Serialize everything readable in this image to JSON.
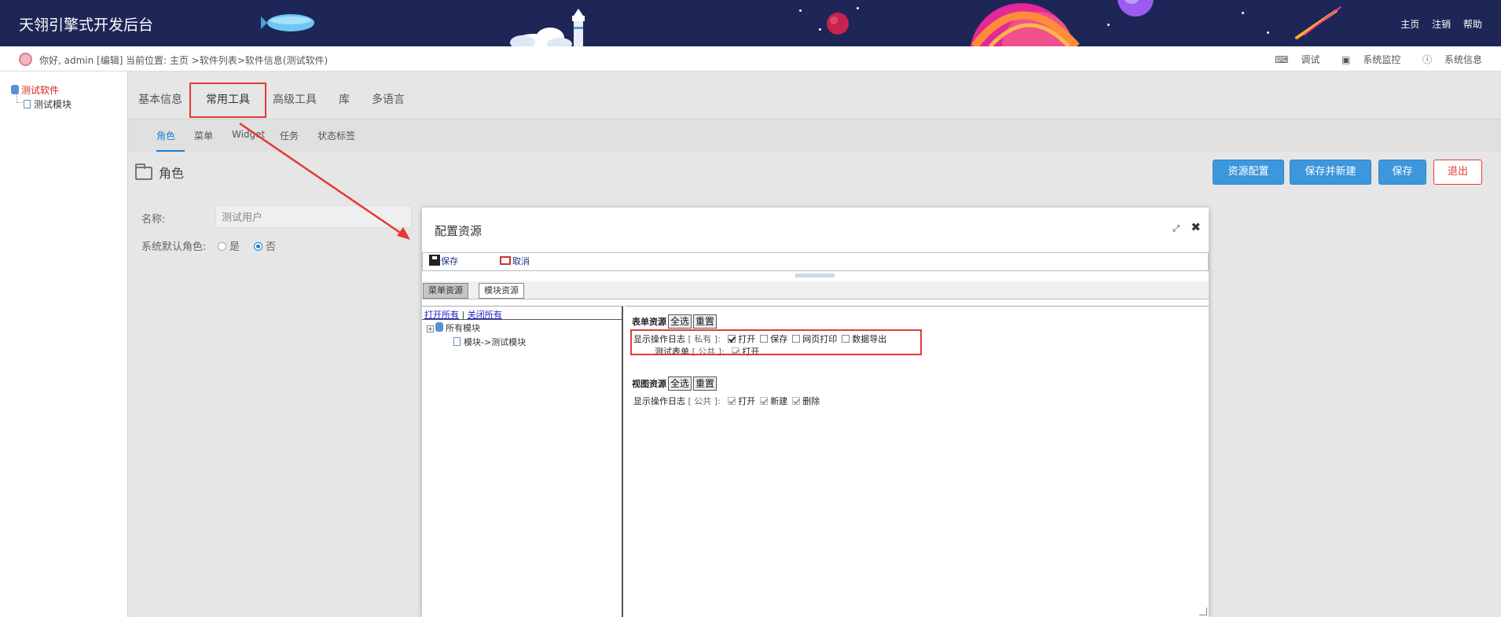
{
  "header": {
    "app_title": "天翎引擎式开发后台",
    "links": [
      "主页",
      "注销",
      "帮助"
    ]
  },
  "userbar": {
    "greeting": "你好, admin [编辑]",
    "location": "当前位置: 主页 >软件列表>软件信息(测试软件)",
    "tools": [
      "调试",
      "系统监控",
      "系统信息"
    ]
  },
  "left_tree": {
    "root": "测试软件",
    "child": "测试模块"
  },
  "main_tabs": [
    "基本信息",
    "常用工具",
    "高级工具",
    "库",
    "多语言"
  ],
  "main_tab_active": "常用工具",
  "sub_tabs": [
    "角色",
    "菜单",
    "Widget",
    "任务",
    "状态标签"
  ],
  "sub_tab_active": "角色",
  "section_title": "角色",
  "buttons": {
    "resource_config": "资源配置",
    "save_and_new": "保存并新建",
    "save": "保存",
    "exit": "退出"
  },
  "form": {
    "name_label": "名称:",
    "name_value": "测试用户",
    "default_role_label": "系统默认角色:",
    "option_yes": "是",
    "option_no": "否",
    "selected": "否"
  },
  "dialog": {
    "title": "配置资源",
    "toolbar_save": "保存",
    "toolbar_cancel": "取消",
    "tabs": [
      "菜单资源",
      "模块资源"
    ],
    "tab_active": "模块资源",
    "tree_links": [
      "打开所有",
      "关闭所有"
    ],
    "tree_link_separator": "|",
    "tree_root": "所有模块",
    "tree_child": "模块->测试模块",
    "form_resources": {
      "header": "表单资源",
      "select_all": "全选",
      "reset": "重置",
      "rows": [
        {
          "name": "显示操作日志",
          "scope": "[ 私有 ]:",
          "options": [
            {
              "label": "打开",
              "checked": true,
              "disabled": false
            },
            {
              "label": "保存",
              "checked": false,
              "disabled": false
            },
            {
              "label": "网页打印",
              "checked": false,
              "disabled": false
            },
            {
              "label": "数据导出",
              "checked": false,
              "disabled": false
            }
          ]
        },
        {
          "name": "测试表单",
          "scope": "[ 公共 ]:",
          "options": [
            {
              "label": "打开",
              "checked": true,
              "disabled": true
            }
          ]
        }
      ]
    },
    "view_resources": {
      "header": "视图资源",
      "select_all": "全选",
      "reset": "重置",
      "rows": [
        {
          "name": "显示操作日志",
          "scope": "[ 公共 ]:",
          "options": [
            {
              "label": "打开",
              "checked": true,
              "disabled": true
            },
            {
              "label": "新建",
              "checked": true,
              "disabled": true
            },
            {
              "label": "删除",
              "checked": true,
              "disabled": true
            }
          ]
        }
      ]
    }
  },
  "colors": {
    "header_bg": "#1e2657",
    "accent_blue": "#3d97dc",
    "highlight_red": "#e53935",
    "tree_root_red": "#e02020"
  }
}
